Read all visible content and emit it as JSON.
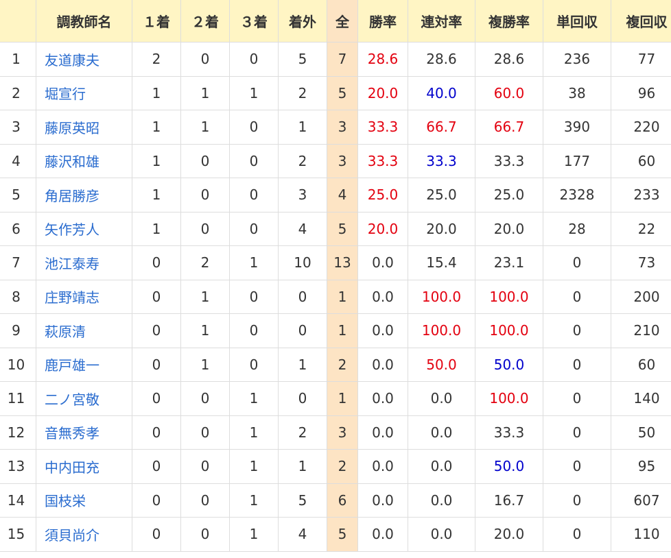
{
  "colors": {
    "header_bg": "#fff5c4",
    "total_col_bg": "#fde4c4",
    "link": "#2a6ccf",
    "red": "#e3000f",
    "blue": "#0000cc",
    "text": "#333333",
    "border": "#dddddd"
  },
  "table": {
    "headers": [
      "",
      "調教師名",
      "１着",
      "２着",
      "３着",
      "着外",
      "全",
      "勝率",
      "連対率",
      "複勝率",
      "単回収",
      "複回収"
    ],
    "rows": [
      {
        "rank": "1",
        "name": "友道康夫",
        "first": "2",
        "second": "0",
        "third": "0",
        "out": "5",
        "total": "7",
        "win": "28.6",
        "win_c": "red",
        "quinella": "28.6",
        "quinella_c": "",
        "place": "28.6",
        "place_c": "",
        "win_ret": "236",
        "place_ret": "77"
      },
      {
        "rank": "2",
        "name": "堀宣行",
        "first": "1",
        "second": "1",
        "third": "1",
        "out": "2",
        "total": "5",
        "win": "20.0",
        "win_c": "red",
        "quinella": "40.0",
        "quinella_c": "blue",
        "place": "60.0",
        "place_c": "red",
        "win_ret": "38",
        "place_ret": "96"
      },
      {
        "rank": "3",
        "name": "藤原英昭",
        "first": "1",
        "second": "1",
        "third": "0",
        "out": "1",
        "total": "3",
        "win": "33.3",
        "win_c": "red",
        "quinella": "66.7",
        "quinella_c": "red",
        "place": "66.7",
        "place_c": "red",
        "win_ret": "390",
        "place_ret": "220"
      },
      {
        "rank": "4",
        "name": "藤沢和雄",
        "first": "1",
        "second": "0",
        "third": "0",
        "out": "2",
        "total": "3",
        "win": "33.3",
        "win_c": "red",
        "quinella": "33.3",
        "quinella_c": "blue",
        "place": "33.3",
        "place_c": "",
        "win_ret": "177",
        "place_ret": "60"
      },
      {
        "rank": "5",
        "name": "角居勝彦",
        "first": "1",
        "second": "0",
        "third": "0",
        "out": "3",
        "total": "4",
        "win": "25.0",
        "win_c": "red",
        "quinella": "25.0",
        "quinella_c": "",
        "place": "25.0",
        "place_c": "",
        "win_ret": "2328",
        "place_ret": "233"
      },
      {
        "rank": "6",
        "name": "矢作芳人",
        "first": "1",
        "second": "0",
        "third": "0",
        "out": "4",
        "total": "5",
        "win": "20.0",
        "win_c": "red",
        "quinella": "20.0",
        "quinella_c": "",
        "place": "20.0",
        "place_c": "",
        "win_ret": "28",
        "place_ret": "22"
      },
      {
        "rank": "7",
        "name": "池江泰寿",
        "first": "0",
        "second": "2",
        "third": "1",
        "out": "10",
        "total": "13",
        "win": "0.0",
        "win_c": "",
        "quinella": "15.4",
        "quinella_c": "",
        "place": "23.1",
        "place_c": "",
        "win_ret": "0",
        "place_ret": "73"
      },
      {
        "rank": "8",
        "name": "庄野靖志",
        "first": "0",
        "second": "1",
        "third": "0",
        "out": "0",
        "total": "1",
        "win": "0.0",
        "win_c": "",
        "quinella": "100.0",
        "quinella_c": "red",
        "place": "100.0",
        "place_c": "red",
        "win_ret": "0",
        "place_ret": "200"
      },
      {
        "rank": "9",
        "name": "萩原清",
        "first": "0",
        "second": "1",
        "third": "0",
        "out": "0",
        "total": "1",
        "win": "0.0",
        "win_c": "",
        "quinella": "100.0",
        "quinella_c": "red",
        "place": "100.0",
        "place_c": "red",
        "win_ret": "0",
        "place_ret": "210"
      },
      {
        "rank": "10",
        "name": "鹿戸雄一",
        "first": "0",
        "second": "1",
        "third": "0",
        "out": "1",
        "total": "2",
        "win": "0.0",
        "win_c": "",
        "quinella": "50.0",
        "quinella_c": "red",
        "place": "50.0",
        "place_c": "blue",
        "win_ret": "0",
        "place_ret": "60"
      },
      {
        "rank": "11",
        "name": "二ノ宮敬",
        "first": "0",
        "second": "0",
        "third": "1",
        "out": "0",
        "total": "1",
        "win": "0.0",
        "win_c": "",
        "quinella": "0.0",
        "quinella_c": "",
        "place": "100.0",
        "place_c": "red",
        "win_ret": "0",
        "place_ret": "140"
      },
      {
        "rank": "12",
        "name": "音無秀孝",
        "first": "0",
        "second": "0",
        "third": "1",
        "out": "2",
        "total": "3",
        "win": "0.0",
        "win_c": "",
        "quinella": "0.0",
        "quinella_c": "",
        "place": "33.3",
        "place_c": "",
        "win_ret": "0",
        "place_ret": "50"
      },
      {
        "rank": "13",
        "name": "中内田充",
        "first": "0",
        "second": "0",
        "third": "1",
        "out": "1",
        "total": "2",
        "win": "0.0",
        "win_c": "",
        "quinella": "0.0",
        "quinella_c": "",
        "place": "50.0",
        "place_c": "blue",
        "win_ret": "0",
        "place_ret": "95"
      },
      {
        "rank": "14",
        "name": "国枝栄",
        "first": "0",
        "second": "0",
        "third": "1",
        "out": "5",
        "total": "6",
        "win": "0.0",
        "win_c": "",
        "quinella": "0.0",
        "quinella_c": "",
        "place": "16.7",
        "place_c": "",
        "win_ret": "0",
        "place_ret": "607"
      },
      {
        "rank": "15",
        "name": "須貝尚介",
        "first": "0",
        "second": "0",
        "third": "1",
        "out": "4",
        "total": "5",
        "win": "0.0",
        "win_c": "",
        "quinella": "0.0",
        "quinella_c": "",
        "place": "20.0",
        "place_c": "",
        "win_ret": "0",
        "place_ret": "110"
      }
    ]
  }
}
